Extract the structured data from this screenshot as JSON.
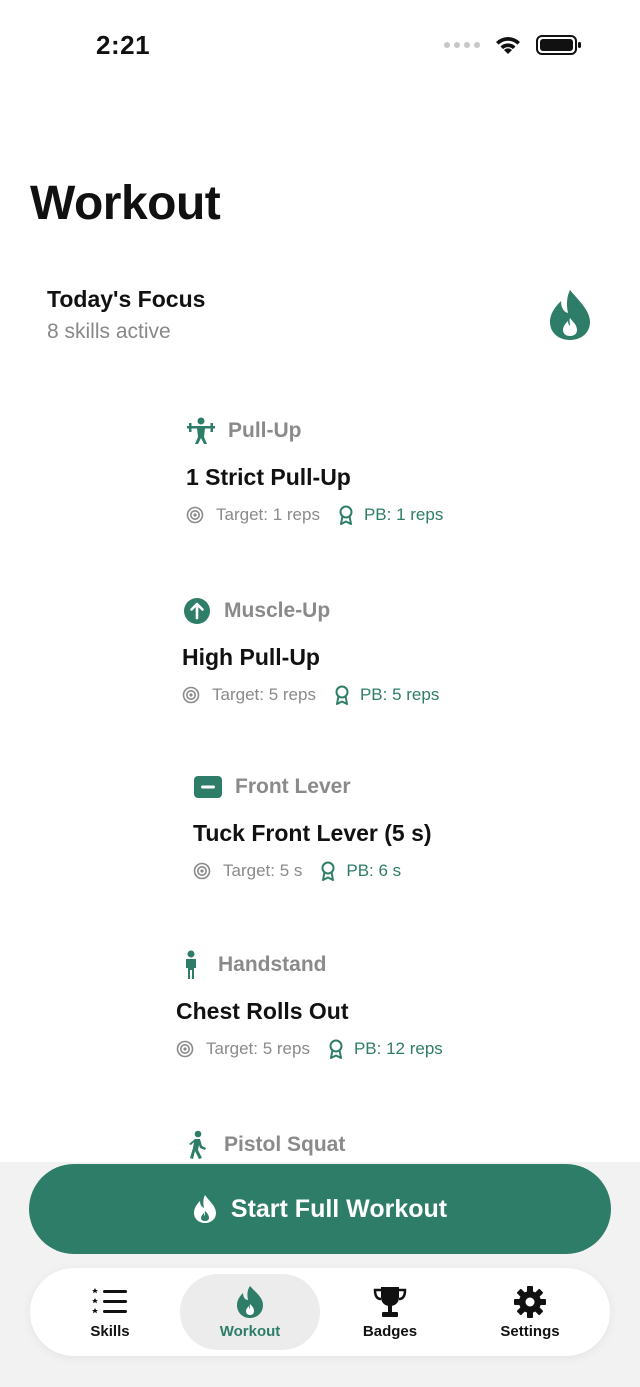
{
  "status": {
    "time": "2:21"
  },
  "page": {
    "title": "Workout"
  },
  "focus": {
    "title": "Today's Focus",
    "subtitle": "8 skills active"
  },
  "skills": [
    {
      "category": "Pull-Up",
      "name": "1 Strict Pull-Up",
      "target": "Target: 1 reps",
      "pb": "PB: 1 reps",
      "icon": "weightlifter-icon"
    },
    {
      "category": "Muscle-Up",
      "name": "High Pull-Up",
      "target": "Target: 5 reps",
      "pb": "PB: 5 reps",
      "icon": "arrow-up-circle-icon"
    },
    {
      "category": "Front Lever",
      "name": "Tuck Front Lever (5 s)",
      "target": "Target: 5 s",
      "pb": "PB: 6 s",
      "icon": "minus-square-icon"
    },
    {
      "category": "Handstand",
      "name": "Chest Rolls Out",
      "target": "Target: 5 reps",
      "pb": "PB: 12 reps",
      "icon": "standing-person-icon"
    },
    {
      "category": "Pistol Squat",
      "icon": "walking-person-icon"
    }
  ],
  "start_button": {
    "label": "Start Full Workout",
    "icon": "flame-icon"
  },
  "tabs": [
    {
      "label": "Skills",
      "icon": "list-icon"
    },
    {
      "label": "Workout",
      "icon": "flame-icon"
    },
    {
      "label": "Badges",
      "icon": "trophy-icon"
    },
    {
      "label": "Settings",
      "icon": "gear-icon"
    }
  ],
  "colors": {
    "accent": "#2e7d68",
    "muted": "#8a8a8a"
  }
}
